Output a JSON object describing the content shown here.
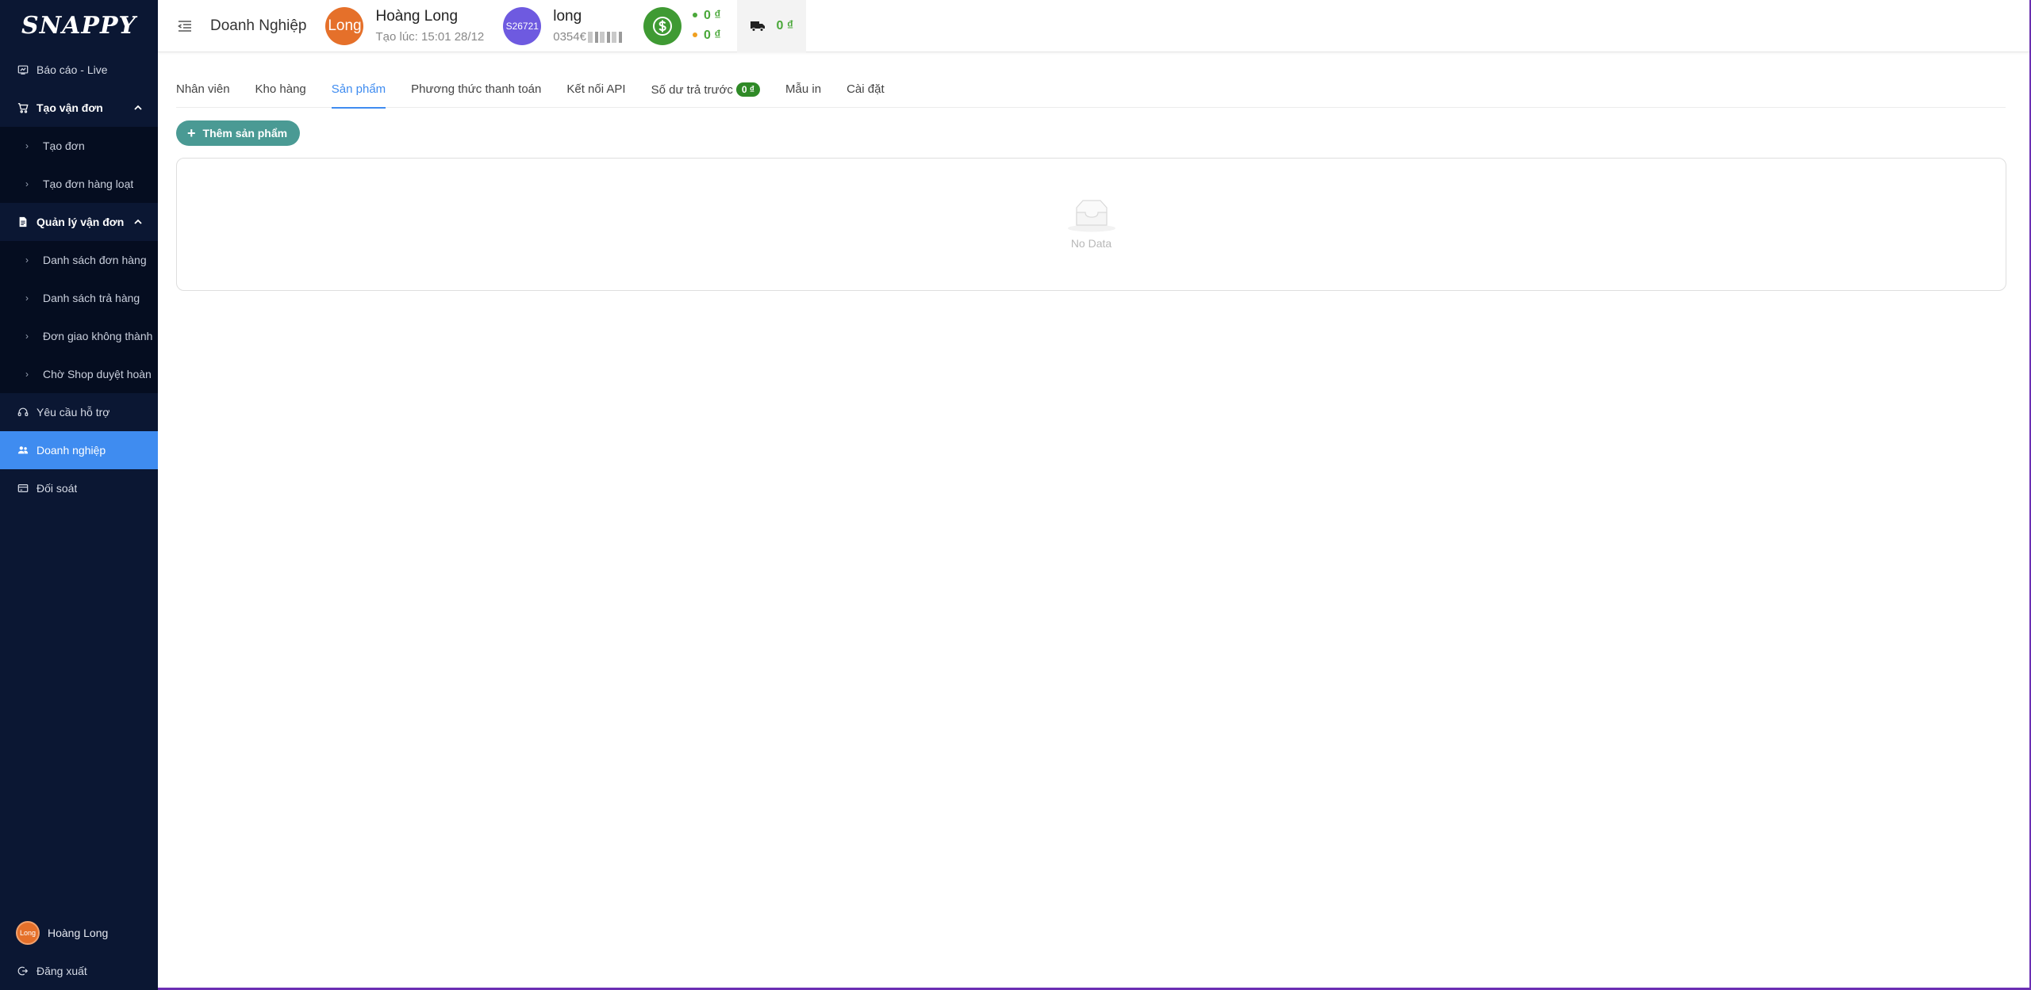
{
  "brand": {
    "logo": "SNAPPY"
  },
  "sidebar": {
    "items": [
      {
        "label": "Báo cáo - Live",
        "icon": "report-icon"
      },
      {
        "label": "Tạo vận đơn",
        "icon": "cart-icon",
        "group": true
      },
      {
        "label": "Tạo đơn",
        "sub": true
      },
      {
        "label": "Tạo đơn hàng loạt",
        "sub": true
      },
      {
        "label": "Quản lý vận đơn",
        "icon": "document-icon",
        "group": true
      },
      {
        "label": "Danh sách đơn hàng",
        "sub": true
      },
      {
        "label": "Danh sách trả hàng",
        "sub": true
      },
      {
        "label": "Đơn giao không thành",
        "sub": true
      },
      {
        "label": "Chờ Shop duyệt hoàn",
        "sub": true
      },
      {
        "label": "Yêu cầu hỗ trợ",
        "icon": "headset-icon"
      },
      {
        "label": "Doanh nghiệp",
        "icon": "users-icon",
        "active": true
      },
      {
        "label": "Đối soát",
        "icon": "card-icon"
      }
    ],
    "user": {
      "avatar_text": "Long",
      "name": "Hoàng Long"
    },
    "logout_label": "Đăng xuất"
  },
  "header": {
    "title": "Doanh Nghiệp",
    "owner": {
      "avatar_text": "Long",
      "name": "Hoàng Long",
      "created": "Tạo lúc: 15:01 28/12"
    },
    "account": {
      "avatar_text": "S26721",
      "name": "long",
      "phone": "0354€"
    },
    "balance_1": "0 ₫",
    "balance_2": "0 ₫",
    "shipping_balance": "0 ₫",
    "colors": {
      "coin": "#3f9a33",
      "balance_text": "#4aa83a",
      "dot_green": "#4aa83a",
      "dot_orange": "#f0a020"
    }
  },
  "tabs": [
    {
      "label": "Nhân viên"
    },
    {
      "label": "Kho hàng"
    },
    {
      "label": "Sản phẩm",
      "active": true
    },
    {
      "label": "Phương thức thanh toán"
    },
    {
      "label": "Kết nối API"
    },
    {
      "label": "Số dư trả trước",
      "badge": "0 ₫"
    },
    {
      "label": "Mẫu in"
    },
    {
      "label": "Cài đặt"
    }
  ],
  "actions": {
    "add_product": "Thêm sản phẩm"
  },
  "empty": {
    "text": "No Data"
  },
  "theme": {
    "sidebar_bg": "#0b1733",
    "active_bg": "#3f8cf0",
    "button_bg": "#4a9a94"
  }
}
